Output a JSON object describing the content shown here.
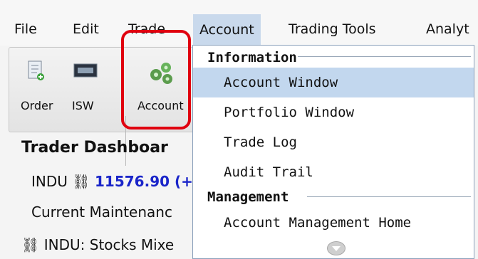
{
  "menubar": {
    "items": [
      "File",
      "Edit",
      "Trade",
      "Account",
      "Trading Tools",
      "Analyt"
    ]
  },
  "toolbar": {
    "buttons": [
      "Order",
      "ISW",
      "Account"
    ]
  },
  "dashboard": {
    "title": "Trader Dashboar",
    "row1_label": "INDU",
    "row1_value": "11576.90 (+",
    "row2": "Current Maintenanc",
    "row3": "INDU: Stocks Mixe"
  },
  "dropdown": {
    "section1": "Information",
    "items1": [
      "Account Window",
      "Portfolio Window",
      "Trade Log",
      "Audit Trail"
    ],
    "section2": "Management",
    "items2": [
      "Account Management Home"
    ]
  }
}
